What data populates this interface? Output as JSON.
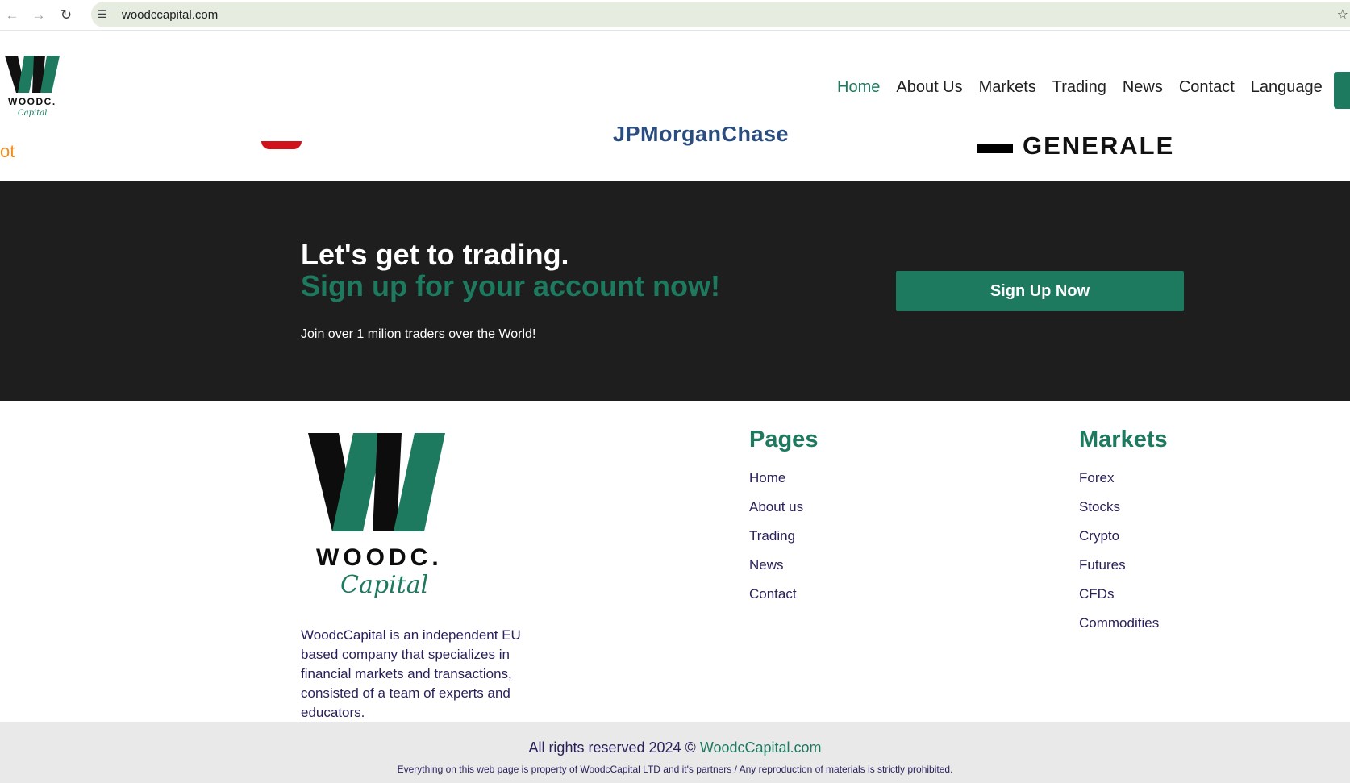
{
  "browser": {
    "url": "woodccapital.com"
  },
  "brand": {
    "logo_word": "WOODC.",
    "logo_script": "Capital",
    "primary_color": "#1d7a5f",
    "dark_color": "#1e1e1e"
  },
  "nav": {
    "items": [
      {
        "label": "Home",
        "active": true
      },
      {
        "label": "About Us",
        "active": false
      },
      {
        "label": "Markets",
        "active": false
      },
      {
        "label": "Trading",
        "active": false
      },
      {
        "label": "News",
        "active": false
      },
      {
        "label": "Contact",
        "active": false
      },
      {
        "label": "Language",
        "active": false
      }
    ]
  },
  "partners": {
    "left_fragment": "ot",
    "middle_fragment": "JPMorganChase",
    "right_fragment": "GENERALE"
  },
  "cta": {
    "title": "Let's get to trading.",
    "subtitle": "Sign up for your account now!",
    "note": "Join over 1 milion traders over the World!",
    "button_label": "Sign Up Now"
  },
  "footer": {
    "about": "WoodcCapital is an independent EU based company that specializes in financial markets and transactions, consisted of a team of experts and educators.",
    "pages": {
      "title": "Pages",
      "links": [
        "Home",
        "About us",
        "Trading",
        "News",
        "Contact"
      ]
    },
    "markets": {
      "title": "Markets",
      "links": [
        "Forex",
        "Stocks",
        "Crypto",
        "Futures",
        "CFDs",
        "Commodities"
      ]
    },
    "rights_prefix": "All rights reserved 2024 © ",
    "rights_brand": "WoodcCapital.com",
    "disclaimer": "Everything on this web page is property of WoodcCapital LTD and it's partners / Any reproduction of materials is strictly prohibited."
  }
}
